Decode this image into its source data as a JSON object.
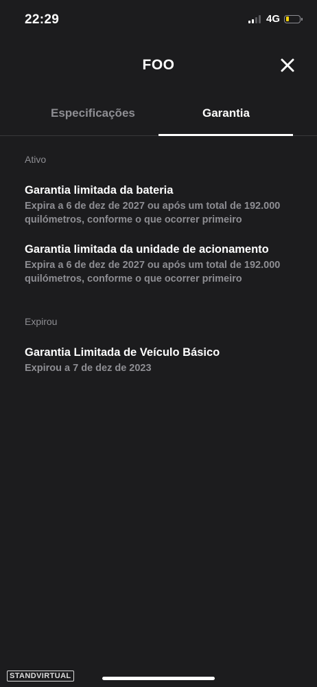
{
  "status_bar": {
    "time": "22:29",
    "network": "4G",
    "signal_icon": "signal-bars-icon",
    "battery_icon": "battery-low-icon",
    "battery_color": "#ffd60a"
  },
  "header": {
    "title": "FOO",
    "close_icon": "close-icon"
  },
  "tabs": [
    {
      "label": "Especificações",
      "active": false
    },
    {
      "label": "Garantia",
      "active": true
    }
  ],
  "sections": [
    {
      "label": "Ativo",
      "items": [
        {
          "title": "Garantia limitada da bateria",
          "description": "Expira a 6 de dez de 2027 ou após um total de 192.000 quilómetros, conforme o que ocorrer primeiro"
        },
        {
          "title": "Garantia limitada da unidade de acionamento",
          "description": "Expira a 6 de dez de 2027 ou após um total de 192.000 quilómetros, conforme o que ocorrer primeiro"
        }
      ]
    },
    {
      "label": "Expirou",
      "items": [
        {
          "title": "Garantia Limitada de Veículo Básico",
          "description": "Expirou a 7 de dez de 2023"
        }
      ]
    }
  ],
  "watermark": "STANDVIRTUAL",
  "colors": {
    "background": "#1c1c1e",
    "text_primary": "#ffffff",
    "text_secondary": "#8e8e93",
    "divider": "#38383a"
  }
}
